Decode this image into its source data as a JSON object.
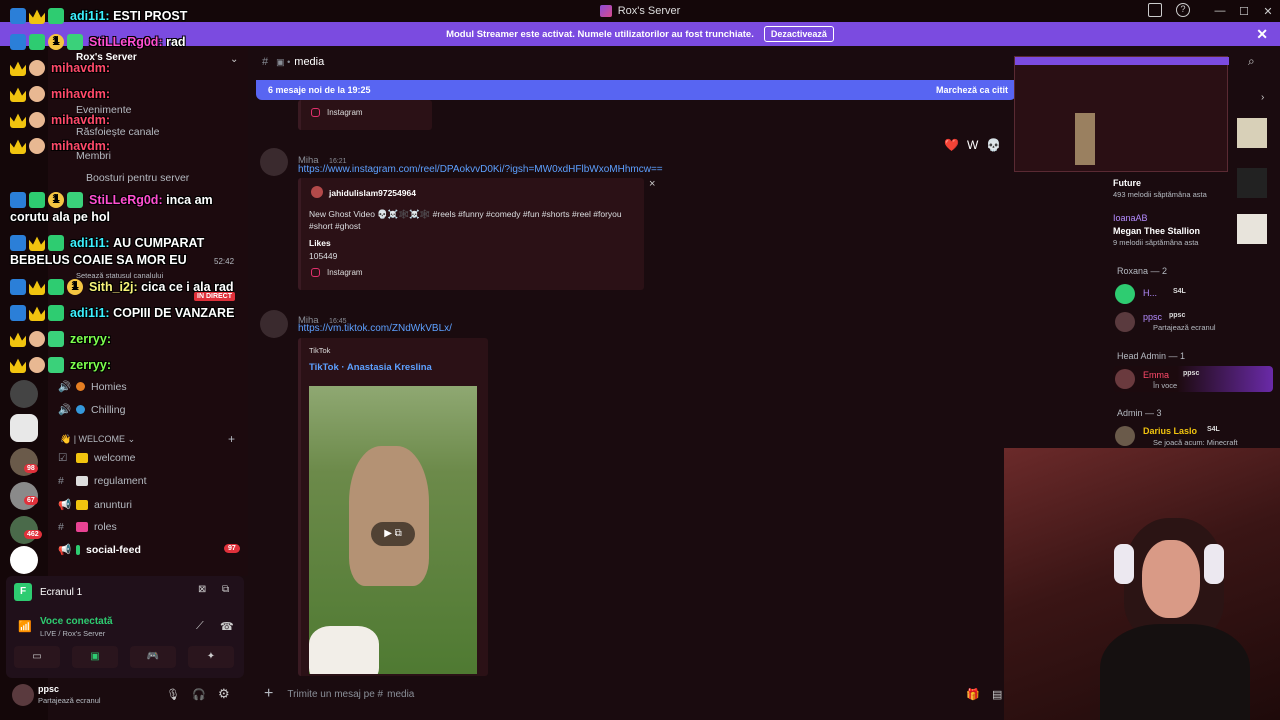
{
  "titlebar": {
    "title": "Rox's Server",
    "controls": [
      "—",
      "☐",
      "✕"
    ]
  },
  "banner": {
    "text": "Modul Streamer este activat. Numele utilizatorilor au fost trunchiate.",
    "button": "Dezactivează"
  },
  "sidebar": {
    "server_name": "Rox's Server",
    "menu": [
      "Evenimente",
      "Răsfoiește canale",
      "Membri",
      "Boosturi pentru server"
    ],
    "status_hint": "Setează statusul canalului",
    "voice_users_live": "IN DIRECT",
    "voice_time": "52:42",
    "channels_voice": [
      "Homies",
      "Chilling"
    ],
    "category": "| WELCOME",
    "channels": [
      {
        "name": "welcome",
        "badge": ""
      },
      {
        "name": "regulament",
        "badge": ""
      },
      {
        "name": "anunturi",
        "badge": ""
      },
      {
        "name": "roles",
        "badge": ""
      },
      {
        "name": "social-feed",
        "badge": "97"
      }
    ]
  },
  "rail_badges": [
    "98",
    "67",
    "462"
  ],
  "voicepanel": {
    "screen": "Ecranul 1",
    "connected": "Voce conectată",
    "connected_sub": "LIVE / Rox's Server",
    "user": "ppsc",
    "user_status": "Partajează ecranul"
  },
  "chat": {
    "channel": "media",
    "new_messages": "6 mesaje noi de la 19:25",
    "new_messages_right": "Marcheză ca citit",
    "top_embed_source": "Instagram",
    "msg1": {
      "author": "Miha",
      "time": "16:21",
      "link": "https://www.instagram.com/reel/DPAokvvD0Ki/?igsh=MW0xdHFlbWxoMHhmcw==",
      "embed_author": "jahidulislam97254964",
      "embed_text": "New Ghost Video 💀☠️🕸️☠️🕸️ #reels #funny #comedy #fun #shorts #reel #foryou #short #ghost",
      "likes_label": "Likes",
      "likes": "105449",
      "source": "Instagram",
      "reactions": [
        "❤️",
        "W",
        "💀"
      ]
    },
    "msg2": {
      "author": "Miha",
      "time": "16:45",
      "link": "https://vm.tiktok.com/ZNdWkVBLx/",
      "embed_provider": "TikTok",
      "embed_title": "TikTok · Anastasia Kreslina"
    },
    "composer_placeholder": "Trimite un mesaj pe #",
    "composer_channel": "media"
  },
  "members": {
    "top": [
      {
        "name": "Future",
        "sub": "493 melodii săptămâna asta"
      },
      {
        "name": "IoanaAB",
        "sub": ""
      },
      {
        "name": "Megan Thee Stallion",
        "sub": "9 melodii săptămâna asta"
      }
    ],
    "group_roxana": "Roxana — 2",
    "roxana_members": [
      {
        "name": "H...",
        "tag": "S4L",
        "sub": ""
      },
      {
        "name": "ppsc",
        "tag": "ppsc",
        "sub": "Partajează ecranul"
      }
    ],
    "group_head_admin": "Head Admin — 1",
    "head_admin": {
      "name": "Emma",
      "tag": "ppsc",
      "sub": "În voce"
    },
    "group_admin": "Admin — 3",
    "admin": {
      "name": "Darius Laslo",
      "tag": "S4L",
      "sub": "Se joacă acum: Minecraft"
    }
  },
  "overlay_chat": [
    {
      "name": "adi1i1:",
      "text": "ESTI PROST",
      "color": "cyan"
    },
    {
      "name": "StiLLeRg0d:",
      "text": "rad",
      "color": "pink"
    },
    {
      "name": "mihavdm:",
      "text": "",
      "color": "red"
    },
    {
      "name": "mihavdm:",
      "text": "",
      "color": "red"
    },
    {
      "name": "mihavdm:",
      "text": "",
      "color": "red"
    },
    {
      "name": "mihavdm:",
      "text": "",
      "color": "red"
    },
    {
      "name": "StiLLeRg0d:",
      "text": "inca am",
      "color": "pink"
    },
    {
      "name": "",
      "text": "corutu ala pe hol",
      "color": "white"
    },
    {
      "name": "adi1i1:",
      "text": "AU CUMPARAT",
      "color": "cyan"
    },
    {
      "name": "",
      "text": "BEBELUS COAIE SA MOR EU",
      "color": "white"
    },
    {
      "name": "Sith_i2j:",
      "text": "cica ce i ala rad",
      "color": "yellow"
    },
    {
      "name": "adi1i1:",
      "text": "COPIII DE VANZARE",
      "color": "cyan"
    },
    {
      "name": "zerryy:",
      "text": "",
      "color": "green"
    },
    {
      "name": "zerryy:",
      "text": "",
      "color": "green"
    }
  ]
}
